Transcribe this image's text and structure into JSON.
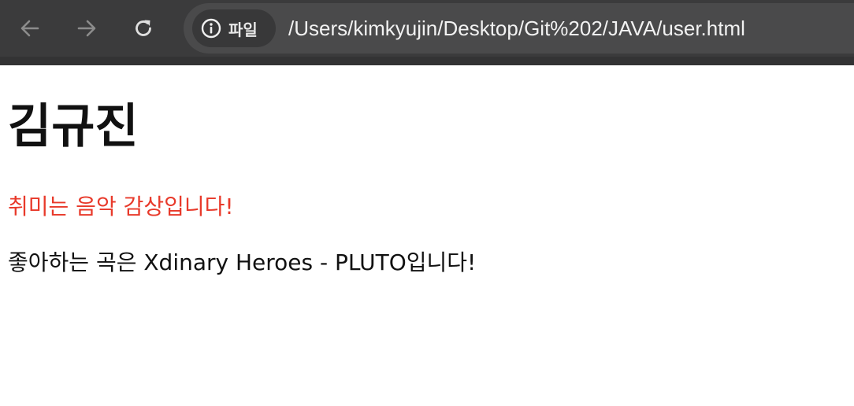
{
  "browser": {
    "site_chip_label": "파일",
    "url": "/Users/kimkyujin/Desktop/Git%202/JAVA/user.html",
    "icons": {
      "back": "arrow-left-icon",
      "forward": "arrow-right-icon",
      "reload": "reload-icon",
      "info": "info-icon"
    },
    "colors": {
      "toolbar": "#3b3b3c",
      "omnibox": "#4a4a4b",
      "chip": "#383839"
    }
  },
  "page": {
    "heading": "김규진",
    "hobby": "취미는 음악 감상입니다!",
    "favorite_song": "좋아하는 곡은 Xdinary Heroes - PLUTO입니다!",
    "colors": {
      "hobby_text": "#e8392a",
      "body_text": "#111111"
    }
  }
}
